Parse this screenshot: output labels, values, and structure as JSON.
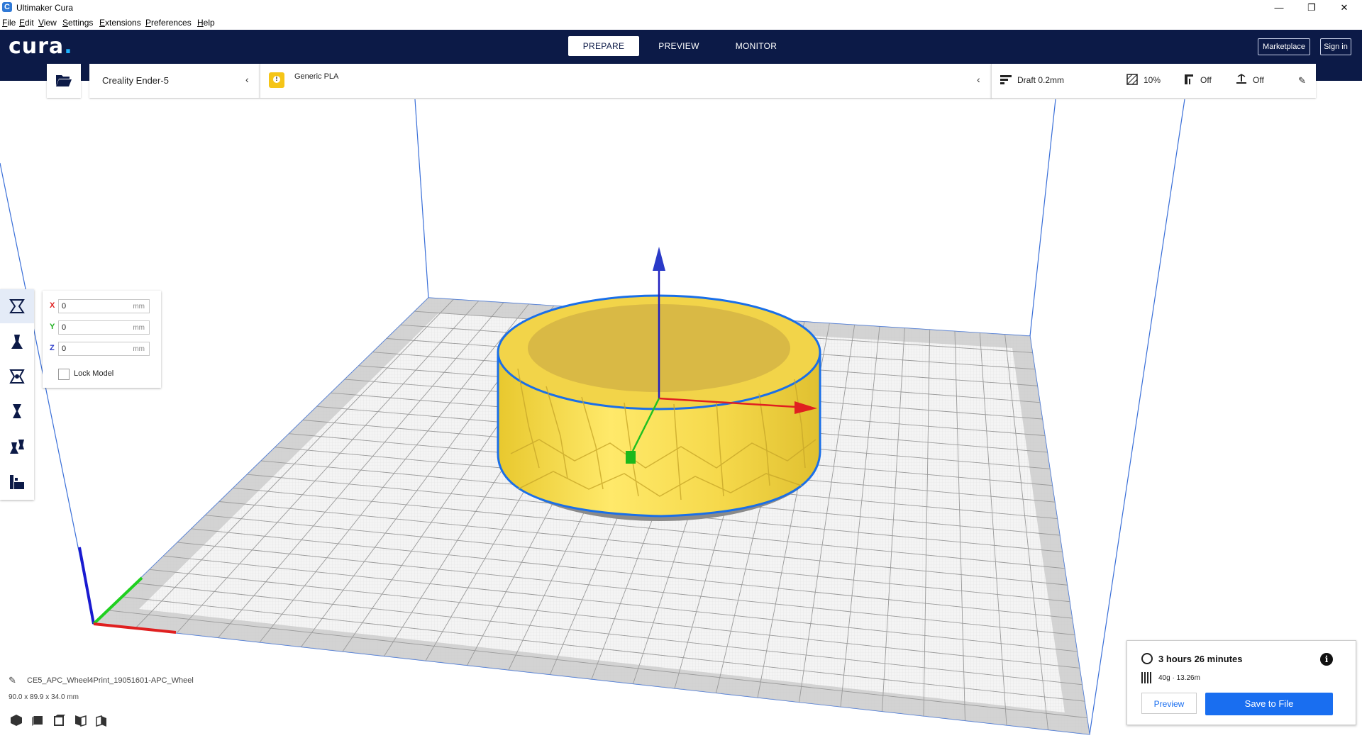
{
  "window": {
    "title": "Ultimaker Cura",
    "minimize": "—",
    "restore": "❐",
    "close": "✕"
  },
  "menu": [
    {
      "accel": "F",
      "rest": "ile"
    },
    {
      "accel": "E",
      "rest": "dit"
    },
    {
      "accel": "V",
      "rest": "iew"
    },
    {
      "accel": "S",
      "rest": "ettings"
    },
    {
      "accel": "E",
      "rest": "xtensions"
    },
    {
      "accel": "P",
      "rest": "references"
    },
    {
      "accel": "H",
      "rest": "elp"
    }
  ],
  "header": {
    "logo": "cura",
    "logo_dot": ".",
    "stages": {
      "prepare": "PREPARE",
      "preview": "PREVIEW",
      "monitor": "MONITOR"
    },
    "marketplace": "Marketplace",
    "signin": "Sign in"
  },
  "top": {
    "printer": "Creality Ender-5",
    "material": "Generic PLA",
    "profile": "Draft 0.2mm",
    "infill": "10%",
    "support": "Off",
    "adhesion": "Off"
  },
  "move": {
    "x": {
      "label": "X",
      "value": "0",
      "unit": "mm"
    },
    "y": {
      "label": "Y",
      "value": "0",
      "unit": "mm"
    },
    "z": {
      "label": "Z",
      "value": "0",
      "unit": "mm"
    },
    "lock": "Lock Model"
  },
  "object": {
    "name": "CE5_APC_Wheel4Print_19051601-APC_Wheel",
    "dimensions": "90.0 x 89.9 x 34.0 mm"
  },
  "print": {
    "time": "3 hours 26 minutes",
    "usage": "40g · 13.26m",
    "preview": "Preview",
    "save": "Save to File"
  },
  "colors": {
    "header": "#0c1a47",
    "accent": "#196ef0",
    "model": "#f5d84a",
    "outline": "#1a6fe8",
    "x_axis": "#e02020",
    "y_axis": "#20c020",
    "z_axis": "#2020c0"
  }
}
